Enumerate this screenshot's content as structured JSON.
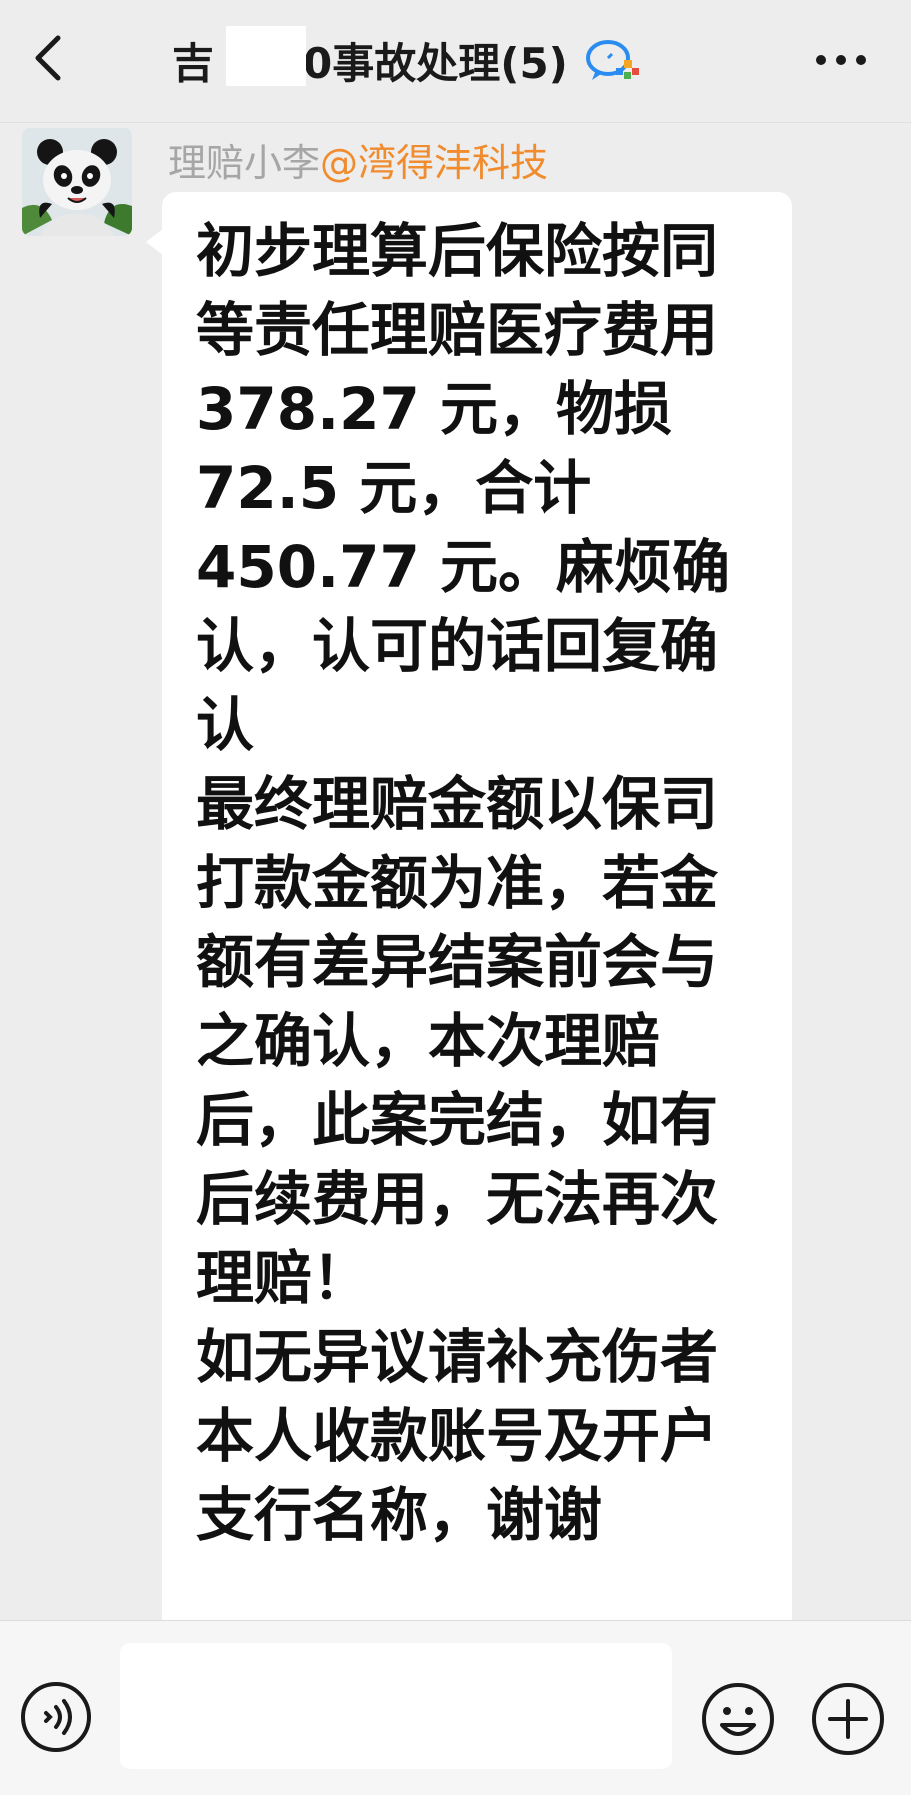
{
  "header": {
    "title": "吉      6.10事故处理(5)",
    "back_icon": "chevron-left-icon",
    "group_icon": "colorful-chat-bubble-icon",
    "more_icon": "more-horizontal-icon"
  },
  "message": {
    "sender_name": "理赔小李",
    "sender_org": "@湾得沣科技",
    "avatar_icon": "panda-avatar",
    "lines": [
      "初步理算后保险按同",
      "等责任理赔医疗费用",
      "378.27 元，物损",
      "72.5 元，合计",
      "450.77 元。麻烦确",
      "认，认可的话回复确",
      "认",
      "最终理赔金额以保司",
      "打款金额为准，若金",
      "额有差异结案前会与",
      "之确认，本次理赔",
      "后，此案完结，如有",
      "后续费用，无法再次",
      "理赔！",
      "如无异议请补充伤者",
      "本人收款账号及开户",
      "支行名称，谢谢"
    ]
  },
  "input_bar": {
    "voice_icon": "voice-icon",
    "emoji_icon": "emoji-icon",
    "plus_icon": "plus-icon",
    "input_value": ""
  },
  "colors": {
    "background": "#ededed",
    "bubble": "#ffffff",
    "sender_name": "#a6a6a6",
    "sender_org": "#f08c2e",
    "text": "#111111"
  }
}
